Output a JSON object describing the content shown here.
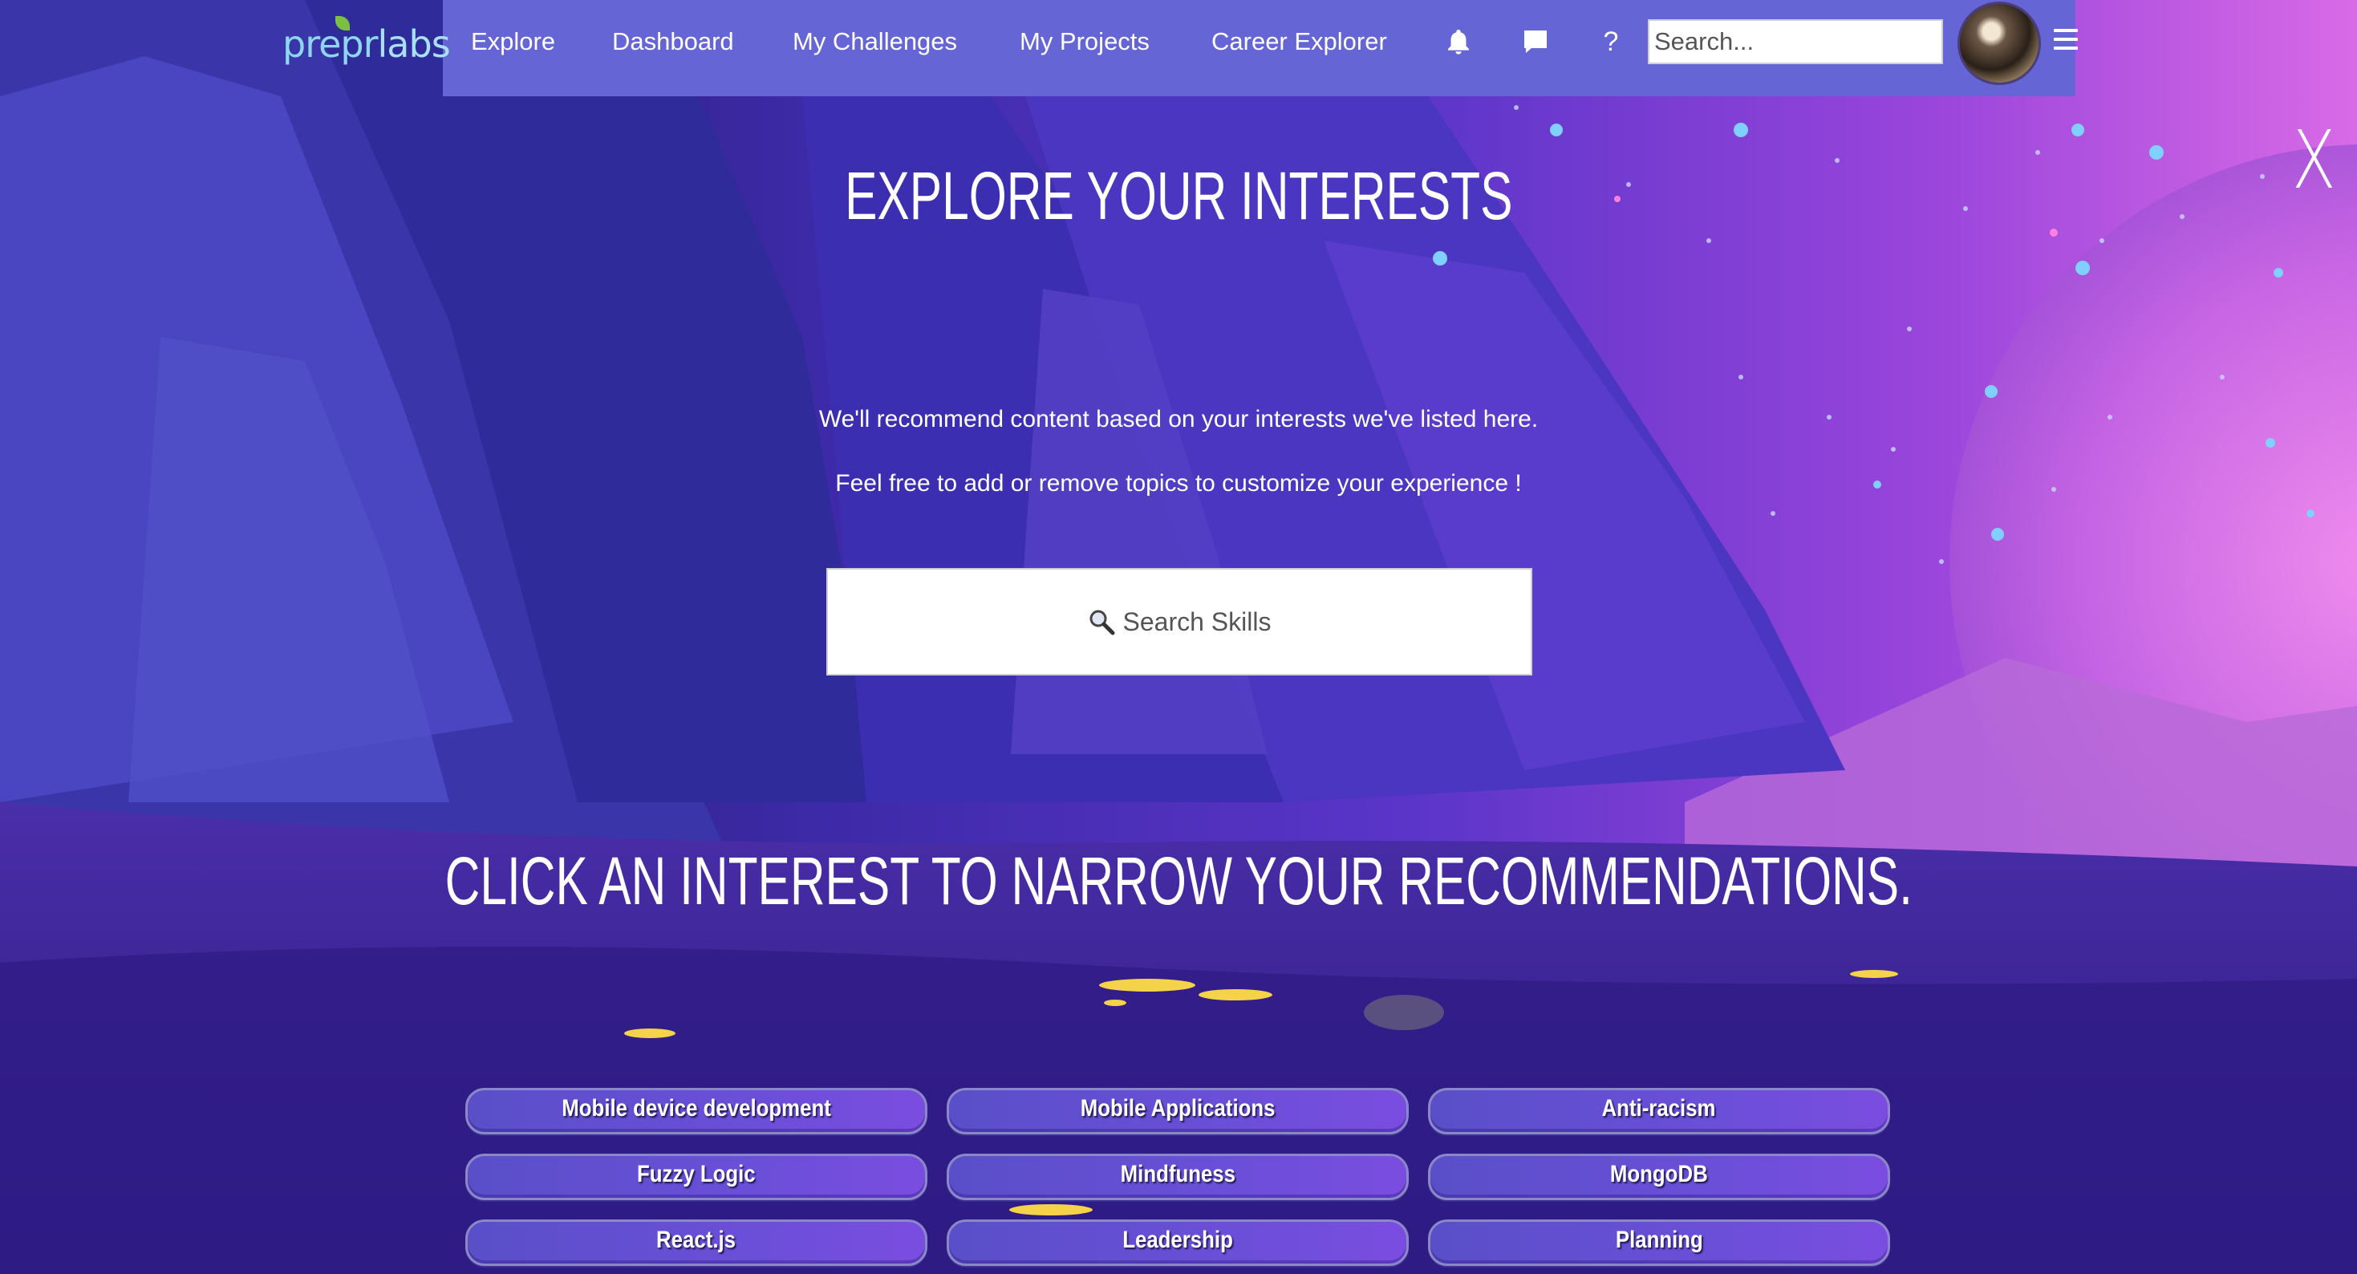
{
  "colors": {
    "nav_bg": "#6565d6",
    "pill_bg": "#5a4fc8",
    "text": "#ffffff"
  },
  "logo": {
    "prefix": "prep",
    "mid": "r",
    "suffix": "labs"
  },
  "nav": {
    "links": [
      "Explore",
      "Dashboard",
      "My Challenges",
      "My Projects",
      "Career Explorer"
    ],
    "icons": [
      "bell-icon",
      "chat-icon",
      "help-icon",
      "menu-icon"
    ],
    "help_glyph": "?",
    "search_placeholder": "Search..."
  },
  "close_label": "X",
  "main": {
    "title": "EXPLORE YOUR INTERESTS",
    "line1": "We'll recommend content based on your interests we've listed here.",
    "line2": "Feel free to add or remove topics to customize your experience !",
    "skill_search_label": "Search Skills",
    "subtitle": "CLICK AN INTEREST TO NARROW YOUR RECOMMENDATIONS."
  },
  "interests": [
    "Mobile device development",
    "Mobile Applications",
    "Anti-racism",
    "Fuzzy Logic",
    "Mindfuness",
    "MongoDB",
    "React.js",
    "Leadership",
    "Planning"
  ]
}
